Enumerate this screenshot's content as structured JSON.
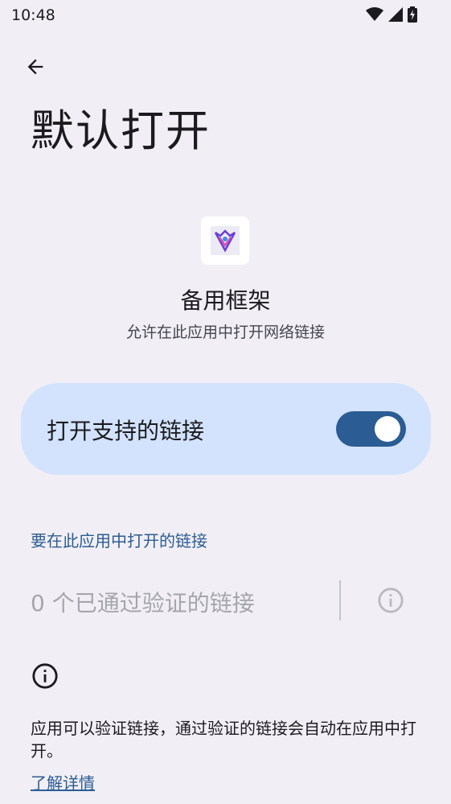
{
  "status_bar": {
    "time": "10:48",
    "icons": [
      "wifi-icon",
      "signal-icon",
      "battery-icon"
    ]
  },
  "header": {
    "back_icon": "arrow-back-icon",
    "title": "默认打开"
  },
  "app": {
    "name": "备用框架",
    "subtitle": "允许在此应用中打开网络链接",
    "icon": "app-icon"
  },
  "toggle": {
    "label": "打开支持的链接",
    "state": "on"
  },
  "links_section": {
    "header": "要在此应用中打开的链接",
    "verified_links_text": "0 个已通过验证的链接",
    "info_icon": "info-icon"
  },
  "footer": {
    "info_icon": "info-icon",
    "text": "应用可以验证链接，通过验证的链接会自动在应用中打开。",
    "learn_more": "了解详情"
  },
  "colors": {
    "background": "#f1eff5",
    "accent": "#2b5c93",
    "card": "#d3e3fd",
    "disabled_text": "#a5a6ad"
  }
}
